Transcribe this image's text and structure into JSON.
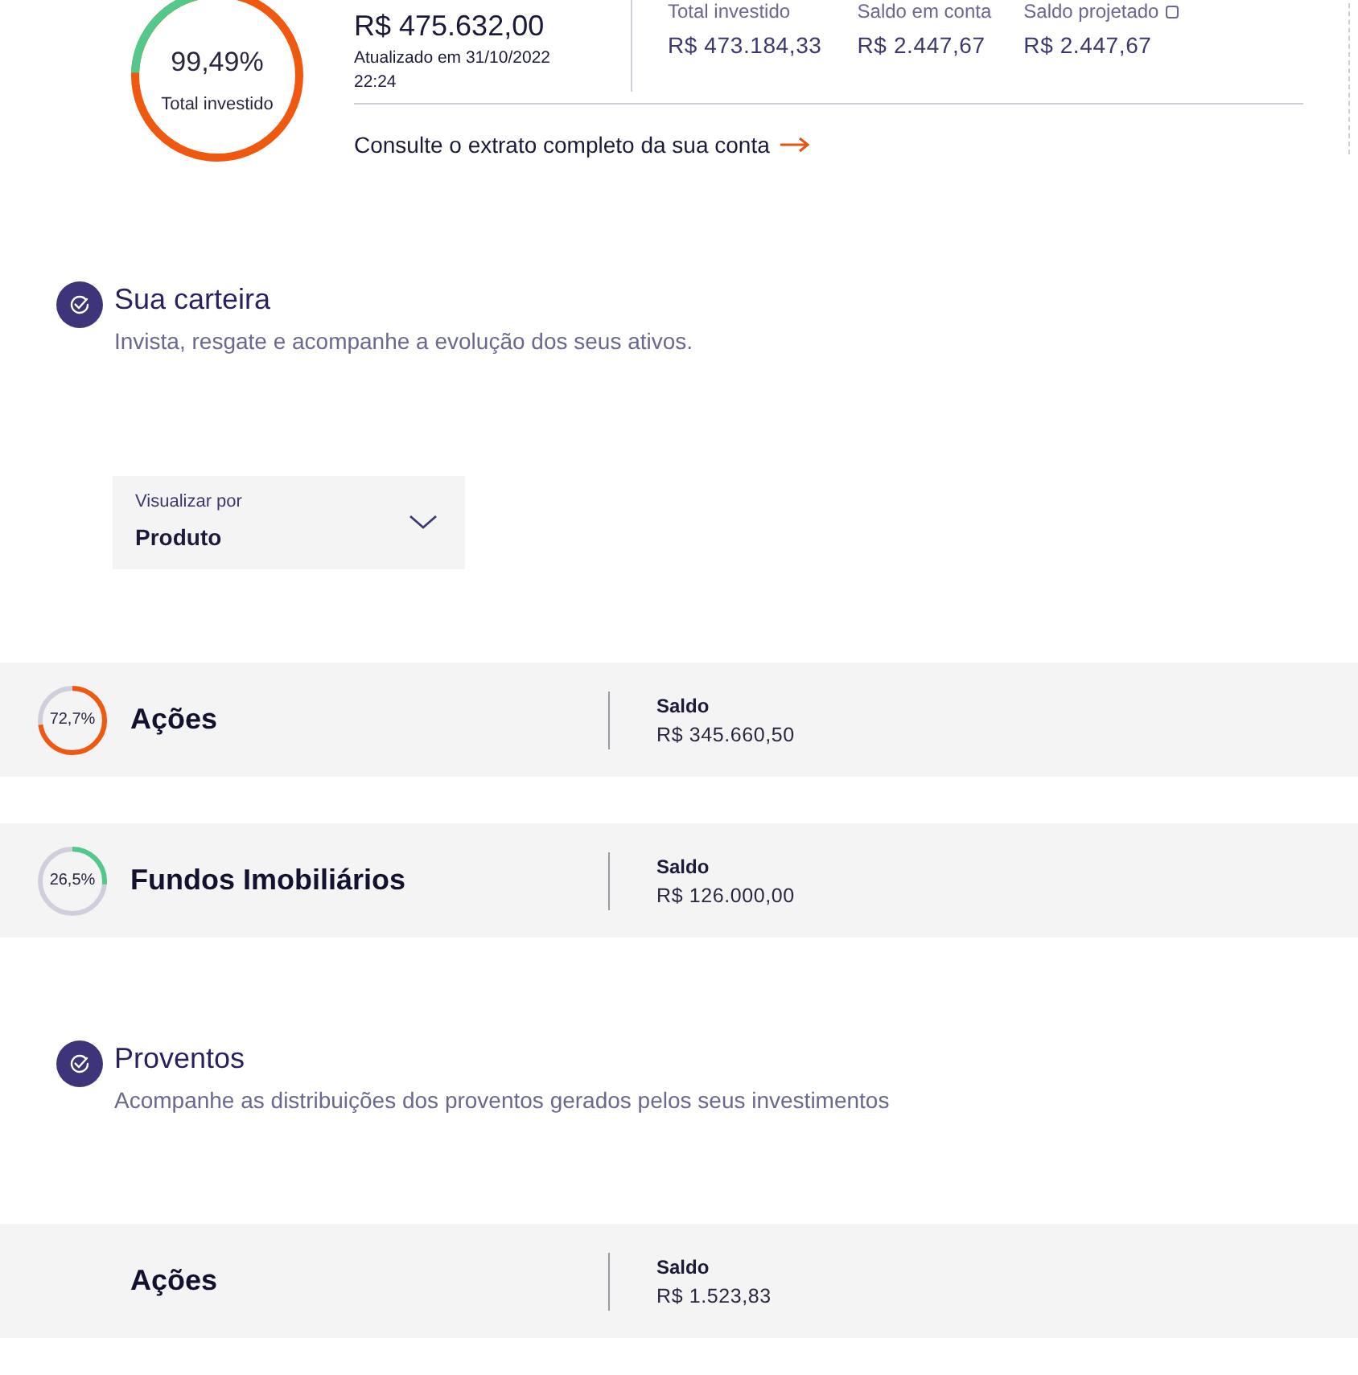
{
  "summary": {
    "donut": {
      "percent": "99,49%",
      "label": "Total investido"
    },
    "total": "R$ 475.632,00",
    "updated": "Atualizado em 31/10/2022 22:24",
    "stats": [
      {
        "label": "Total investido",
        "value": "R$ 473.184,33",
        "info": false
      },
      {
        "label": "Saldo em conta",
        "value": "R$ 2.447,67",
        "info": false
      },
      {
        "label": "Saldo projetado",
        "value": "R$ 2.447,67",
        "info": true
      }
    ],
    "statement_link": "Consulte o extrato completo da sua conta"
  },
  "portfolio": {
    "title": "Sua carteira",
    "subtitle": "Invista, resgate e acompanhe a evolução dos seus ativos.",
    "view_select": {
      "label": "Visualizar por",
      "value": "Produto"
    },
    "assets": [
      {
        "name": "Ações",
        "percent": "72,7%",
        "level": 0.727,
        "color": "#f0570f",
        "balance_label": "Saldo",
        "balance": "R$ 345.660,50"
      },
      {
        "name": "Fundos Imobiliários",
        "percent": "26,5%",
        "level": 0.265,
        "color": "#52c98a",
        "balance_label": "Saldo",
        "balance": "R$ 126.000,00"
      }
    ]
  },
  "earnings": {
    "title": "Proventos",
    "subtitle": "Acompanhe as distribuições dos proventos gerados pelos seus investimentos",
    "assets": [
      {
        "name": "Ações",
        "balance_label": "Saldo",
        "balance": "R$ 1.523,83"
      }
    ]
  }
}
